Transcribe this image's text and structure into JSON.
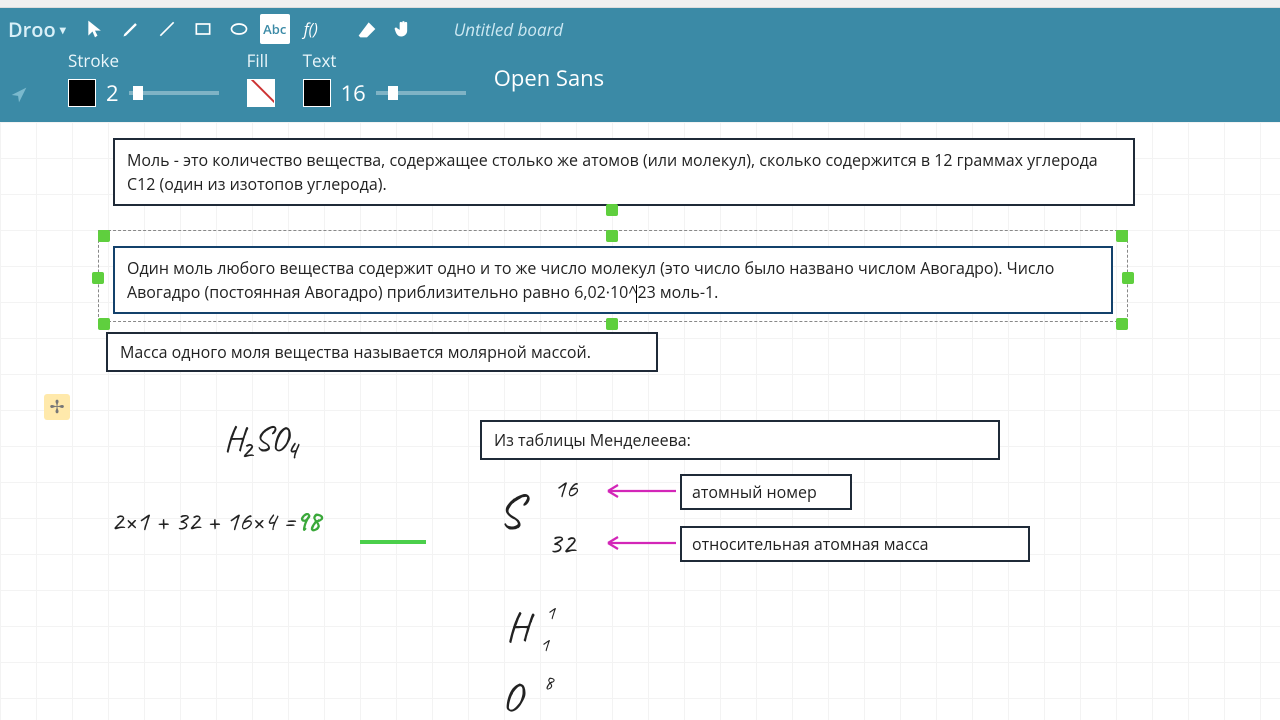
{
  "brand": "Droo",
  "board_title": "Untitled board",
  "toolbar": {
    "select": "select",
    "pen": "pen",
    "line": "line",
    "rect": "rect",
    "ellipse": "ellipse",
    "text_tool_label": "Abc",
    "formula": "f()",
    "eraser": "eraser",
    "hand": "hand"
  },
  "props": {
    "stroke_label": "Stroke",
    "stroke_value": "2",
    "fill_label": "Fill",
    "text_label": "Text",
    "text_size": "16",
    "font": "Open Sans"
  },
  "notes": {
    "n1": "Моль - это количество вещества, содержащее столько же атомов (или молекул), сколько содержится в 12 граммах углерода С12 (один из изотопов углерода).",
    "n2_a": "Один моль любого вещества содержит одно и то же число молекул (это число было названо числом Авогадро). Число Авогадро (постоянная Авогадро) приблизительно равно 6,02·10^",
    "n2_b": "23 моль-1.",
    "n3": "Масса одного моля вещества называется молярной массой.",
    "n4": "Из таблицы Менделеева:",
    "n5": "атомный номер",
    "n6": "относительная атомная масса"
  },
  "handwriting": {
    "formula": "H₂SO₄",
    "calc_a": "2×1 + 32 + 16×4 =",
    "calc_b": "98",
    "S": "S",
    "s_top": "16",
    "s_bot": "32",
    "H": "H",
    "h_top": "1",
    "h_bot": "1",
    "O": "O",
    "o_top": "8"
  }
}
